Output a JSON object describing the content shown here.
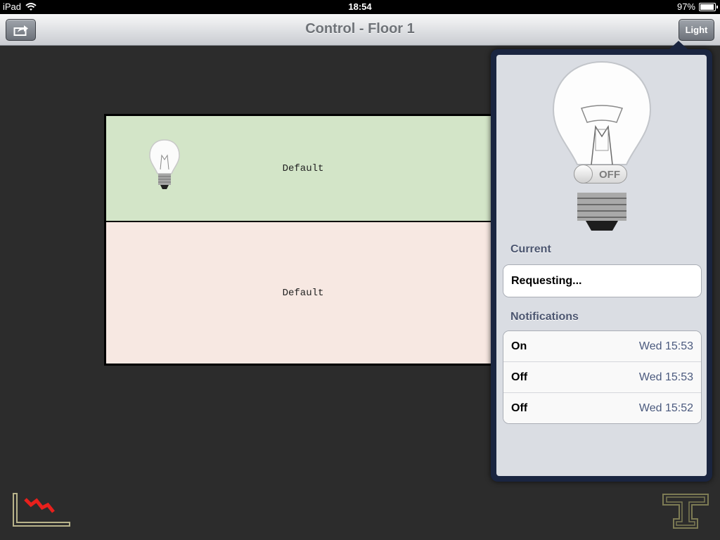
{
  "status_bar": {
    "device": "iPad",
    "time": "18:54",
    "battery": "97%"
  },
  "nav": {
    "title": "Control - Floor 1",
    "light_button": "Light"
  },
  "floor": {
    "zones": [
      {
        "label": "Default"
      },
      {
        "label": "Default"
      }
    ]
  },
  "popover": {
    "toggle_label": "OFF",
    "current_header": "Current",
    "current_value": "Requesting...",
    "notifications_header": "Notifications",
    "notifications": [
      {
        "state": "On",
        "time": "Wed 15:53"
      },
      {
        "state": "Off",
        "time": "Wed 15:53"
      },
      {
        "state": "Off",
        "time": "Wed 15:52"
      }
    ]
  },
  "icons": {
    "share": "share-icon",
    "wifi": "wifi-icon",
    "bulb": "lightbulb-icon",
    "chart": "chart-icon",
    "text_tool": "text-tool-icon"
  },
  "colors": {
    "zone_green": "#d3e5c8",
    "zone_pink": "#f7e8e2",
    "popover_frame": "#1a2540",
    "alert_red": "#e8201c"
  }
}
